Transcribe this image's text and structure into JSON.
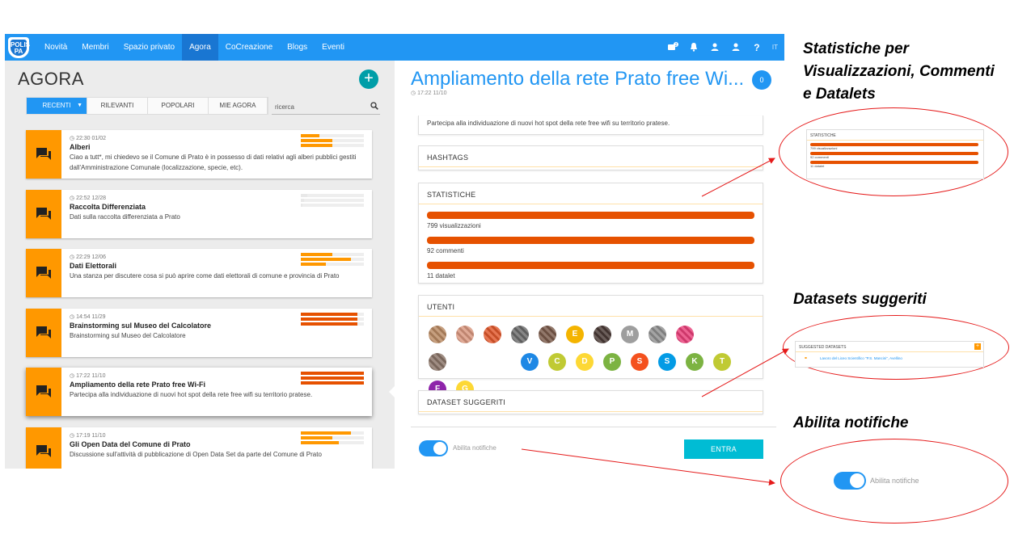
{
  "nav": {
    "logo_text": "POLIS PA",
    "items": [
      "Novità",
      "Membri",
      "Spazio privato",
      "Agora",
      "CoCreazione",
      "Blogs",
      "Eventi"
    ],
    "active": "Agora",
    "lang": "IT",
    "badge": "2"
  },
  "left": {
    "title": "AGORA",
    "add_label": "+",
    "tabs": [
      {
        "label": "RECENTI",
        "active": true
      },
      {
        "label": "RILEVANTI"
      },
      {
        "label": "POPOLARI"
      },
      {
        "label": "MIE AGORA"
      }
    ],
    "search_placeholder": "ricerca",
    "rooms": [
      {
        "time": "22:30 01/02",
        "title": "Alberi",
        "desc": "Ciao a tutt*, mi chiedevo se il Comune di Prato è in possesso di dati relativi agli alberi pubblici gestiti dall'Amministrazione Comunale (localizzazione, specie, etc).",
        "bars": [
          0.3,
          0.5,
          0.5
        ]
      },
      {
        "time": "22:52 12/28",
        "title": "Raccolta Differenziata",
        "desc": "Dati sulla raccolta differenziata a Prato",
        "bars": [
          0.1,
          0.05,
          0.02
        ]
      },
      {
        "time": "22:29 12/06",
        "title": "Dati Elettorali",
        "desc": "Una stanza per discutere cosa si può aprire come dati elettorali di comune e provincia di Prato",
        "bars": [
          0.5,
          0.8,
          0.4
        ]
      },
      {
        "time": "14:54 11/29",
        "title": "Brainstorming sul Museo del Calcolatore",
        "desc": "Brainstorming sul Museo del Calcolatore",
        "bars": [
          0.9,
          0.9,
          0.9
        ]
      },
      {
        "time": "17:22 11/10",
        "title": "Ampliamento della rete Prato free Wi-Fi",
        "desc": "Partecipa alla individuazione di nuovi hot spot della rete free wifi su territorio pratese.",
        "bars": [
          1.0,
          1.0,
          1.0
        ],
        "selected": true
      },
      {
        "time": "17:19 11/10",
        "title": "Gli Open Data del Comune di Prato",
        "desc": "Discussione sull'attività di pubblicazione di Open Data Set da parte del Comune di Prato",
        "bars": [
          0.8,
          0.5,
          0.6
        ]
      }
    ]
  },
  "right": {
    "title": "Ampliamento della rete Prato free Wi...",
    "time": "17:22 11/10",
    "badge": "0",
    "description": "Partecipa alla individuazione di nuovi hot spot della rete free wifi su territorio pratese.",
    "hashtags_header": "HASHTAGS",
    "stats_header": "STATISTICHE",
    "stats": [
      {
        "label": "799 visualizzazioni",
        "value": 1.0
      },
      {
        "label": "92 commenti",
        "value": 1.0
      },
      {
        "label": "11 datalet",
        "value": 1.0
      }
    ],
    "users_header": "UTENTI",
    "users": [
      {
        "letter": "",
        "color": "#b98a63"
      },
      {
        "letter": "",
        "color": "#d9977f"
      },
      {
        "letter": "",
        "color": "#e0582c"
      },
      {
        "letter": "",
        "color": "#6b6b6b"
      },
      {
        "letter": "",
        "color": "#7a5a4a"
      },
      {
        "letter": "E",
        "color": "#f4b400"
      },
      {
        "letter": "",
        "color": "#4a3a36"
      },
      {
        "letter": "M",
        "color": "#9e9e9e"
      },
      {
        "letter": "",
        "color": "#909090"
      },
      {
        "letter": "",
        "color": "#e9407a"
      },
      {
        "letter": "",
        "color": "#8a7468"
      },
      {
        "letter": "V",
        "color": "#1e88e5"
      },
      {
        "letter": "C",
        "color": "#c0ca33"
      },
      {
        "letter": "D",
        "color": "#fdd835"
      },
      {
        "letter": "P",
        "color": "#7cb342"
      },
      {
        "letter": "S",
        "color": "#f4511e"
      },
      {
        "letter": "S",
        "color": "#039be5"
      },
      {
        "letter": "K",
        "color": "#7cb342"
      },
      {
        "letter": "T",
        "color": "#c0ca33"
      },
      {
        "letter": "F",
        "color": "#8e24aa"
      },
      {
        "letter": "G",
        "color": "#fdd835"
      }
    ],
    "datasets_header": "DATASET SUGGERITI",
    "notify_label": "Abilita notifiche",
    "enter_label": "ENTRA"
  },
  "annotations": {
    "stats_caption_l1": "Statistiche per",
    "stats_caption_l2": "Visualizzazioni, Commenti",
    "stats_caption_l3": "e  Datalets",
    "datasets_caption": "Datasets suggeriti",
    "notify_caption": "Abilita notifiche",
    "inset_stats_header": "STATISTICHE",
    "inset_stats": [
      "799 visualizzazioni",
      "92 commenti",
      "11 datalet"
    ],
    "inset_datasets_header": "SUGGESTED DATASETS",
    "inset_dataset_item": "Lavoro del Liceo Scientifico \"P.S. Mancini\", Avellino",
    "inset_notify_label": "Abilita notifiche"
  },
  "colors": {
    "primary": "#2196f3",
    "accent_orange": "#ff9800",
    "stat_bar": "#e65100",
    "teal": "#009ea8",
    "enter": "#00bcd4",
    "annotation_red": "#e51a1a"
  }
}
